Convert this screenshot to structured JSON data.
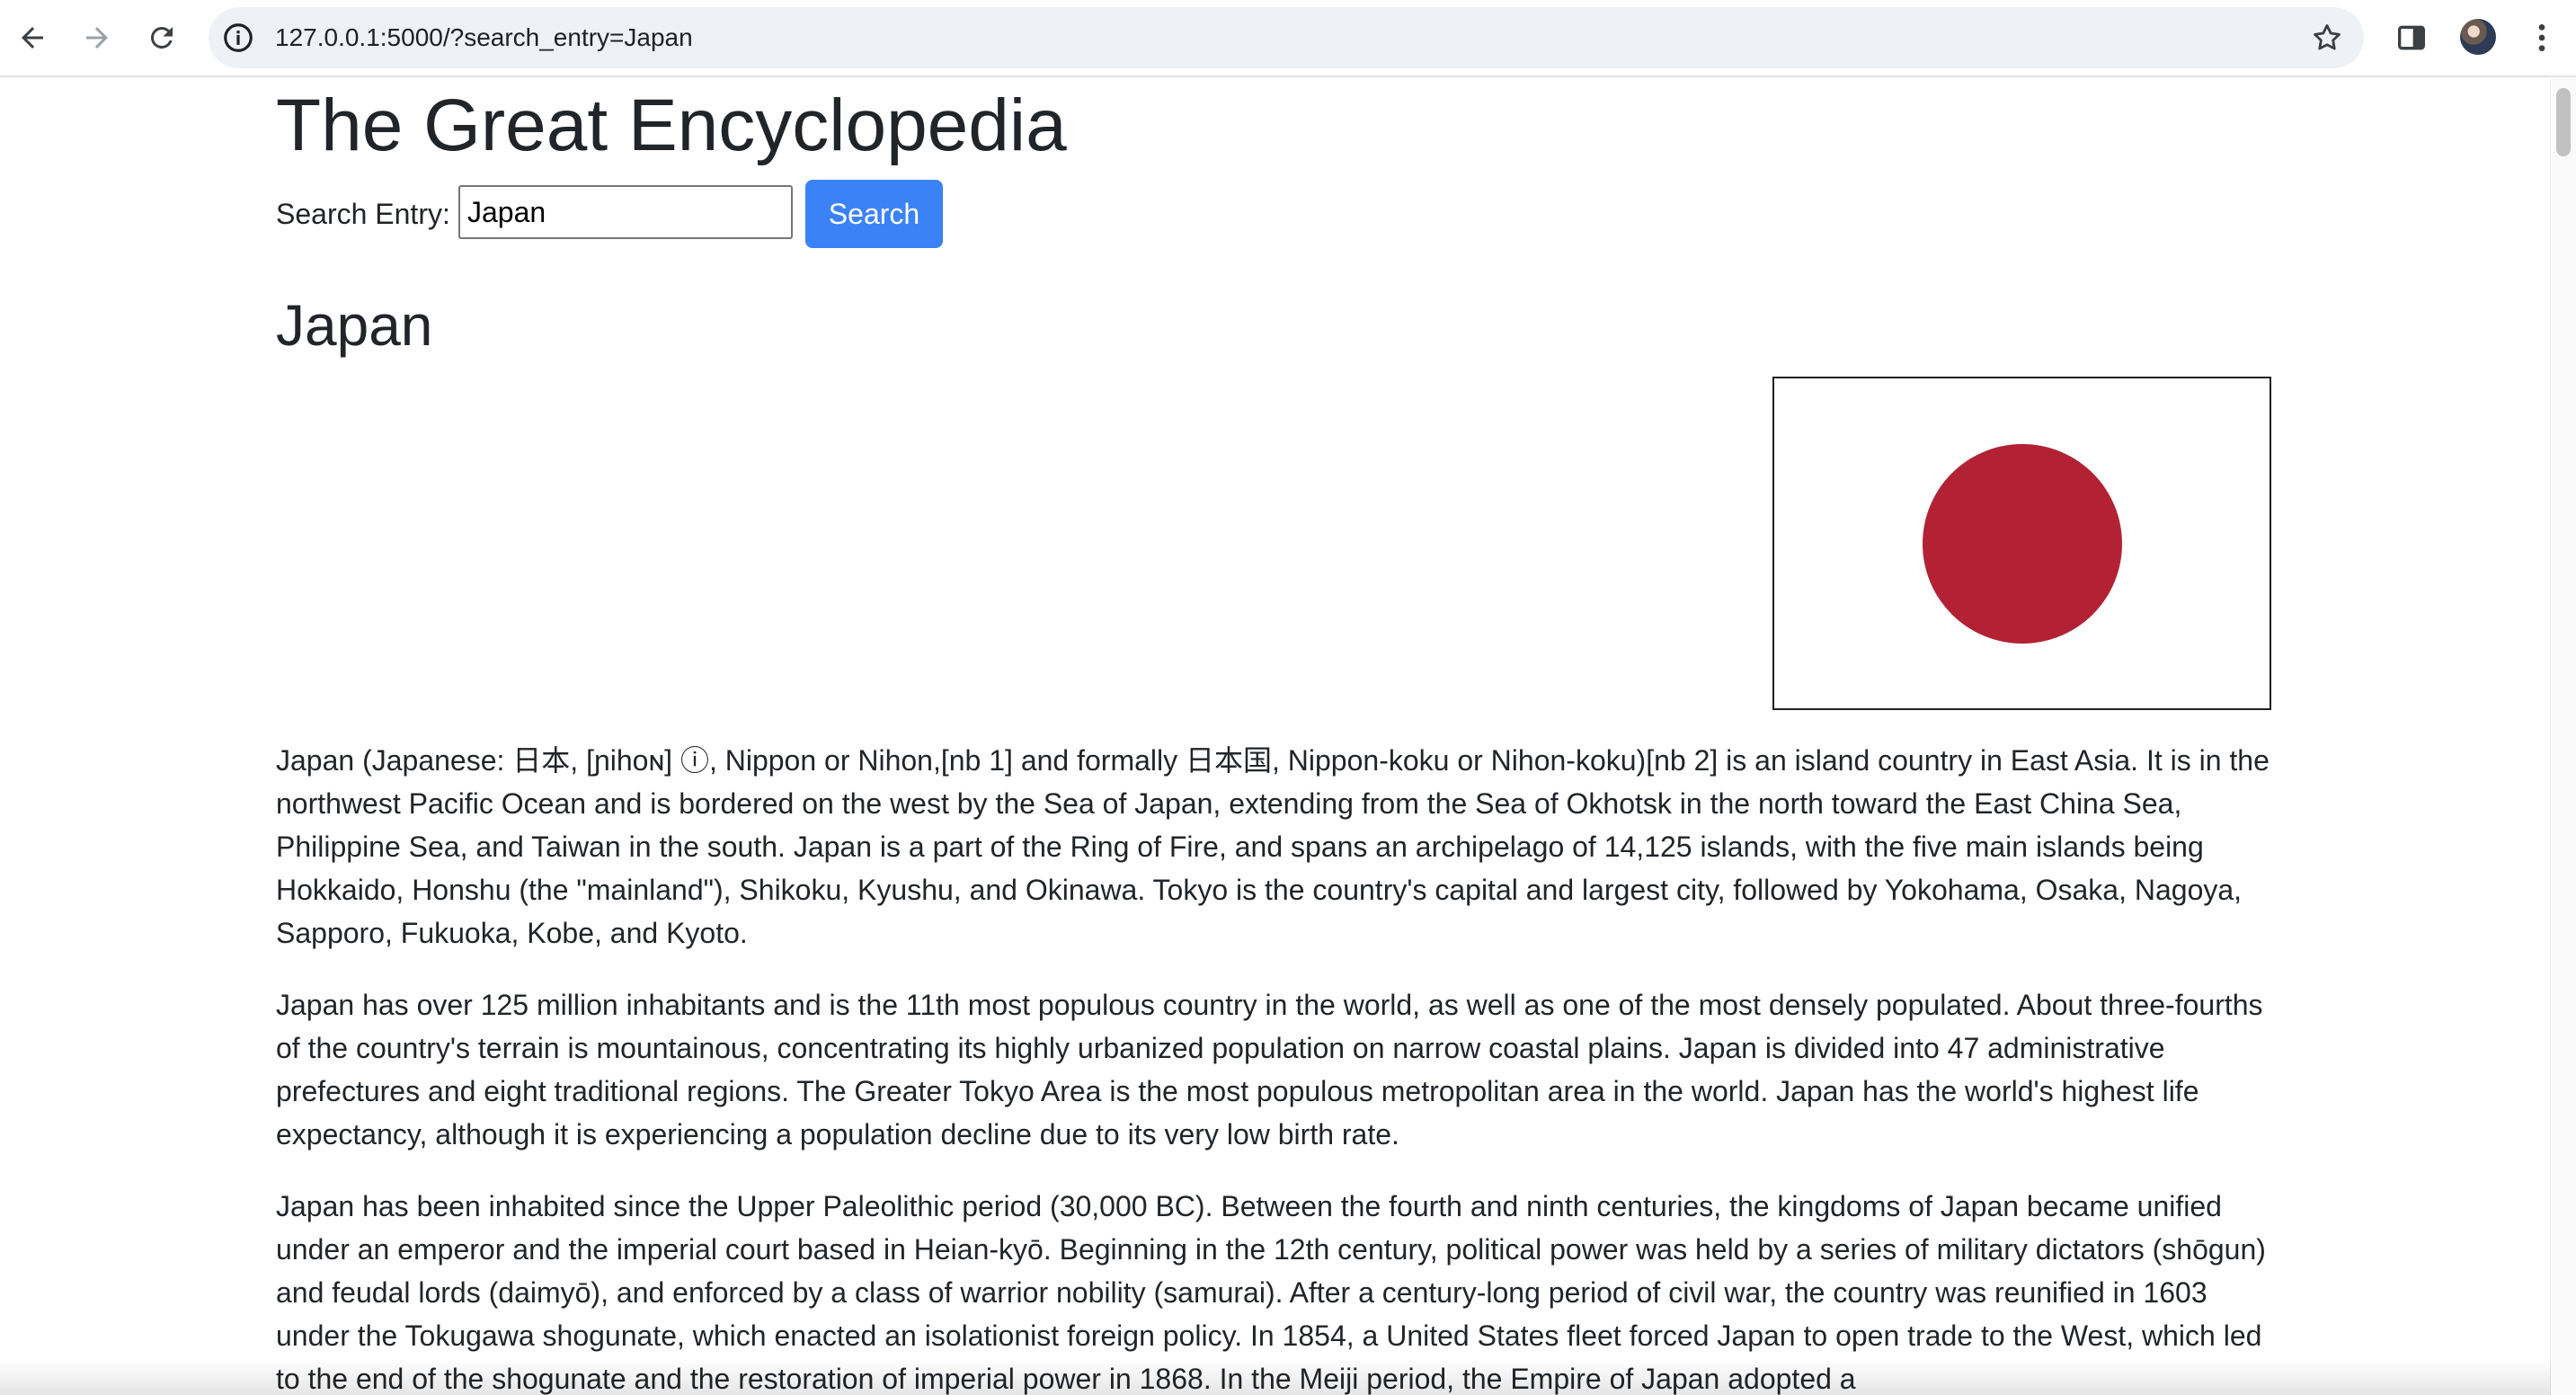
{
  "browser": {
    "url": "127.0.0.1:5000/?search_entry=Japan",
    "icons": [
      "back-arrow-icon",
      "forward-arrow-icon",
      "reload-icon",
      "site-info-icon",
      "bookmark-star-icon",
      "side-panel-icon",
      "profile-avatar",
      "kebab-menu-icon"
    ]
  },
  "page": {
    "site_title": "The Great Encyclopedia",
    "search": {
      "label": "Search Entry:",
      "value": "Japan",
      "button_label": "Search"
    },
    "entry": {
      "title": "Japan",
      "flag_image": {
        "description_icon": "japan-flag",
        "disc_color": "#b22234"
      },
      "paragraphs": [
        "Japan (Japanese: 日本, [ɲihoɴ] ⓘ, Nippon or Nihon,[nb 1] and formally 日本国, Nippon-koku or Nihon-koku)[nb 2] is an island country in East Asia. It is in the northwest Pacific Ocean and is bordered on the west by the Sea of Japan, extending from the Sea of Okhotsk in the north toward the East China Sea, Philippine Sea, and Taiwan in the south. Japan is a part of the Ring of Fire, and spans an archipelago of 14,125 islands, with the five main islands being Hokkaido, Honshu (the \"mainland\"), Shikoku, Kyushu, and Okinawa. Tokyo is the country's capital and largest city, followed by Yokohama, Osaka, Nagoya, Sapporo, Fukuoka, Kobe, and Kyoto.",
        "Japan has over 125 million inhabitants and is the 11th most populous country in the world, as well as one of the most densely populated. About three-fourths of the country's terrain is mountainous, concentrating its highly urbanized population on narrow coastal plains. Japan is divided into 47 administrative prefectures and eight traditional regions. The Greater Tokyo Area is the most populous metropolitan area in the world. Japan has the world's highest life expectancy, although it is experiencing a population decline due to its very low birth rate.",
        "Japan has been inhabited since the Upper Paleolithic period (30,000 BC). Between the fourth and ninth centuries, the kingdoms of Japan became unified under an emperor and the imperial court based in Heian-kyō. Beginning in the 12th century, political power was held by a series of military dictators (shōgun) and feudal lords (daimyō), and enforced by a class of warrior nobility (samurai). After a century-long period of civil war, the country was reunified in 1603 under the Tokugawa shogunate, which enacted an isolationist foreign policy. In 1854, a United States fleet forced Japan to open trade to the West, which led to the end of the shogunate and the restoration of imperial power in 1868. In the Meiji period, the Empire of Japan adopted a"
      ]
    }
  }
}
